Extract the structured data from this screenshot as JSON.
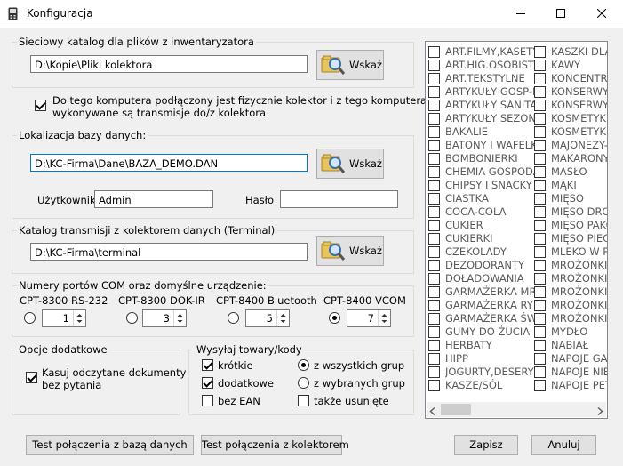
{
  "window": {
    "title": "Konfiguracja"
  },
  "inventory_group": {
    "legend": "Sieciowy katalog dla plików z inwentaryzatora",
    "path": "D:\\Kopie\\Pliki kolektora",
    "browse_label": "Wskaż"
  },
  "collector_checkbox": {
    "checked": true,
    "label_line1": "Do tego komputera podłączony jest fizycznie kolektor i z tego komputera",
    "label_line2": "wykonywane są transmisje do/z kolektora"
  },
  "database_group": {
    "legend": "Lokalizacja bazy danych:",
    "path": "D:\\KC-Firma\\Dane\\BAZA_DEMO.DAN",
    "browse_label": "Wskaż",
    "user_label": "Użytkownik",
    "user_value": "Admin",
    "password_label": "Hasło",
    "password_value": ""
  },
  "transmission_group": {
    "legend": "Katalog transmisji z kolektorem danych (Terminal)",
    "path": "D:\\KC-Firma\\terminal",
    "browse_label": "Wskaż"
  },
  "com_group": {
    "legend": "Numery portów COM oraz domyślne urządzenie:",
    "devices": [
      {
        "label": "CPT-8300 RS-232",
        "port": "1",
        "selected": false
      },
      {
        "label": "CPT-8300 DOK-IR",
        "port": "3",
        "selected": false
      },
      {
        "label": "CPT-8400 Bluetooth",
        "port": "5",
        "selected": false
      },
      {
        "label": "CPT-8400 VCOM",
        "port": "7",
        "selected": true
      }
    ]
  },
  "extra_options": {
    "legend": "Opcje dodatkowe",
    "delete_docs_line1": "Kasuj odczytane dokumenty",
    "delete_docs_line2": "bez pytania",
    "delete_docs_checked": true
  },
  "send_group": {
    "legend": "Wysyłaj towary/kody",
    "short_label": "krótkie",
    "short_checked": true,
    "additional_label": "dodatkowe",
    "additional_checked": true,
    "no_ean_label": "bez EAN",
    "no_ean_checked": false,
    "all_groups_label": "z wszystkich grup",
    "all_groups_selected": true,
    "selected_groups_label": "z wybranych grup",
    "selected_groups_selected": false,
    "deleted_too_label": "także usunięte",
    "deleted_too_checked": false
  },
  "groups_list": {
    "column1": [
      "ART.FILMY,KASETY",
      "ART.HIG.OSOBISTE",
      "ART.TEKSTYLNE",
      "ARTYKUŁY GOSP-P",
      "ARTYKUŁY SANITA",
      "ARTYKUŁY SEZONC",
      "BAKALIE",
      "BATONY I WAFELKI",
      "BOMBONIERKI",
      "CHEMIA GOSPODAR",
      "CHIPSY I SNACKY",
      "CIASTKA",
      "COCA-COLA",
      "CUKIER",
      "CUKIERKI",
      "CZEKOLADY",
      "DEZODORANTY",
      "DOŁADOWANIA",
      "GARMAŻERKA MRC",
      "GARMAŻERKA RYB",
      "GARMAŻERKA ŚWII",
      "GUMY DO ŻUCIA",
      "HERBATY",
      "HIPP",
      "JOGURTY,DESERY",
      "KASZE/SÓL"
    ],
    "column2": [
      "KASZKI DLA",
      "KAWY",
      "KONCENTRA",
      "KONSERWY",
      "KONSERWY",
      "KOSMETYKI",
      "KOSMETYKI",
      "MAJONEZY-S",
      "MAKARONY",
      "MASŁO",
      "MĄKI",
      "MIĘSO",
      "MIĘSO DROI",
      "MIĘSO PAKC",
      "MIĘSO PIEC",
      "MLEKO W PI",
      "MROŻONKI-I",
      "MROŻONKI-I",
      "MROŻONKI-I",
      "MROŻONKI-I",
      "MROŻONKI-I",
      "MYDŁO",
      "NABIAŁ",
      "NAPOJE GAZ",
      "NAPOJE NIE",
      "NAPOJE PET"
    ]
  },
  "footer": {
    "test_db_label": "Test połączenia z bazą danych",
    "test_collector_label": "Test połączenia z kolektorem",
    "save_label": "Zapisz",
    "cancel_label": "Anuluj"
  }
}
